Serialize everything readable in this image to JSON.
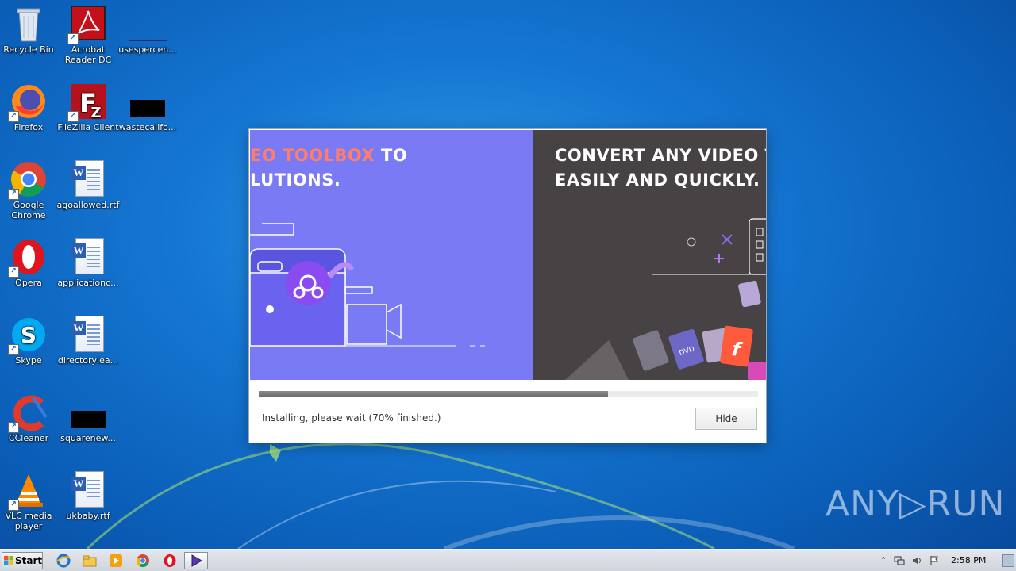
{
  "desktop": {
    "icons": [
      {
        "id": "recycle-bin",
        "label": "Recycle Bin"
      },
      {
        "id": "acrobat",
        "label": "Acrobat Reader DC"
      },
      {
        "id": "usespercent",
        "label": "usespercen..."
      },
      {
        "id": "firefox",
        "label": "Firefox"
      },
      {
        "id": "filezilla",
        "label": "FileZilla Client"
      },
      {
        "id": "wastecalifo",
        "label": "wastecalifo..."
      },
      {
        "id": "chrome",
        "label": "Google Chrome"
      },
      {
        "id": "agoallowed",
        "label": "agoallowed.rtf"
      },
      {
        "id": "opera",
        "label": "Opera"
      },
      {
        "id": "applicationc",
        "label": "applicationc..."
      },
      {
        "id": "skype",
        "label": "Skype"
      },
      {
        "id": "directorylea",
        "label": "directorylea..."
      },
      {
        "id": "ccleaner",
        "label": "CCleaner"
      },
      {
        "id": "squarenew",
        "label": "squarenew..."
      },
      {
        "id": "vlc",
        "label": "VLC media player"
      },
      {
        "id": "ukbaby",
        "label": "ukbaby.rtf"
      }
    ]
  },
  "installer": {
    "banner_left": {
      "line1_accent": "EO TOOLBOX",
      "line1_rest": " TO",
      "line2": "LUTIONS."
    },
    "banner_right": {
      "line1": "CONVERT ANY VIDEO TO OV",
      "line2": "EASILY AND QUICKLY."
    },
    "progress_fraction": 0.7,
    "status_text": "Installing, please wait (70% finished.)",
    "hide_label": "Hide"
  },
  "watermark": "ANY▷RUN",
  "taskbar": {
    "start_label": "Start",
    "clock": "2:58 PM",
    "pinned": [
      "internet-explorer-icon",
      "explorer-icon",
      "media-player-icon",
      "chrome-icon",
      "opera-icon",
      "installer-app-icon"
    ]
  }
}
